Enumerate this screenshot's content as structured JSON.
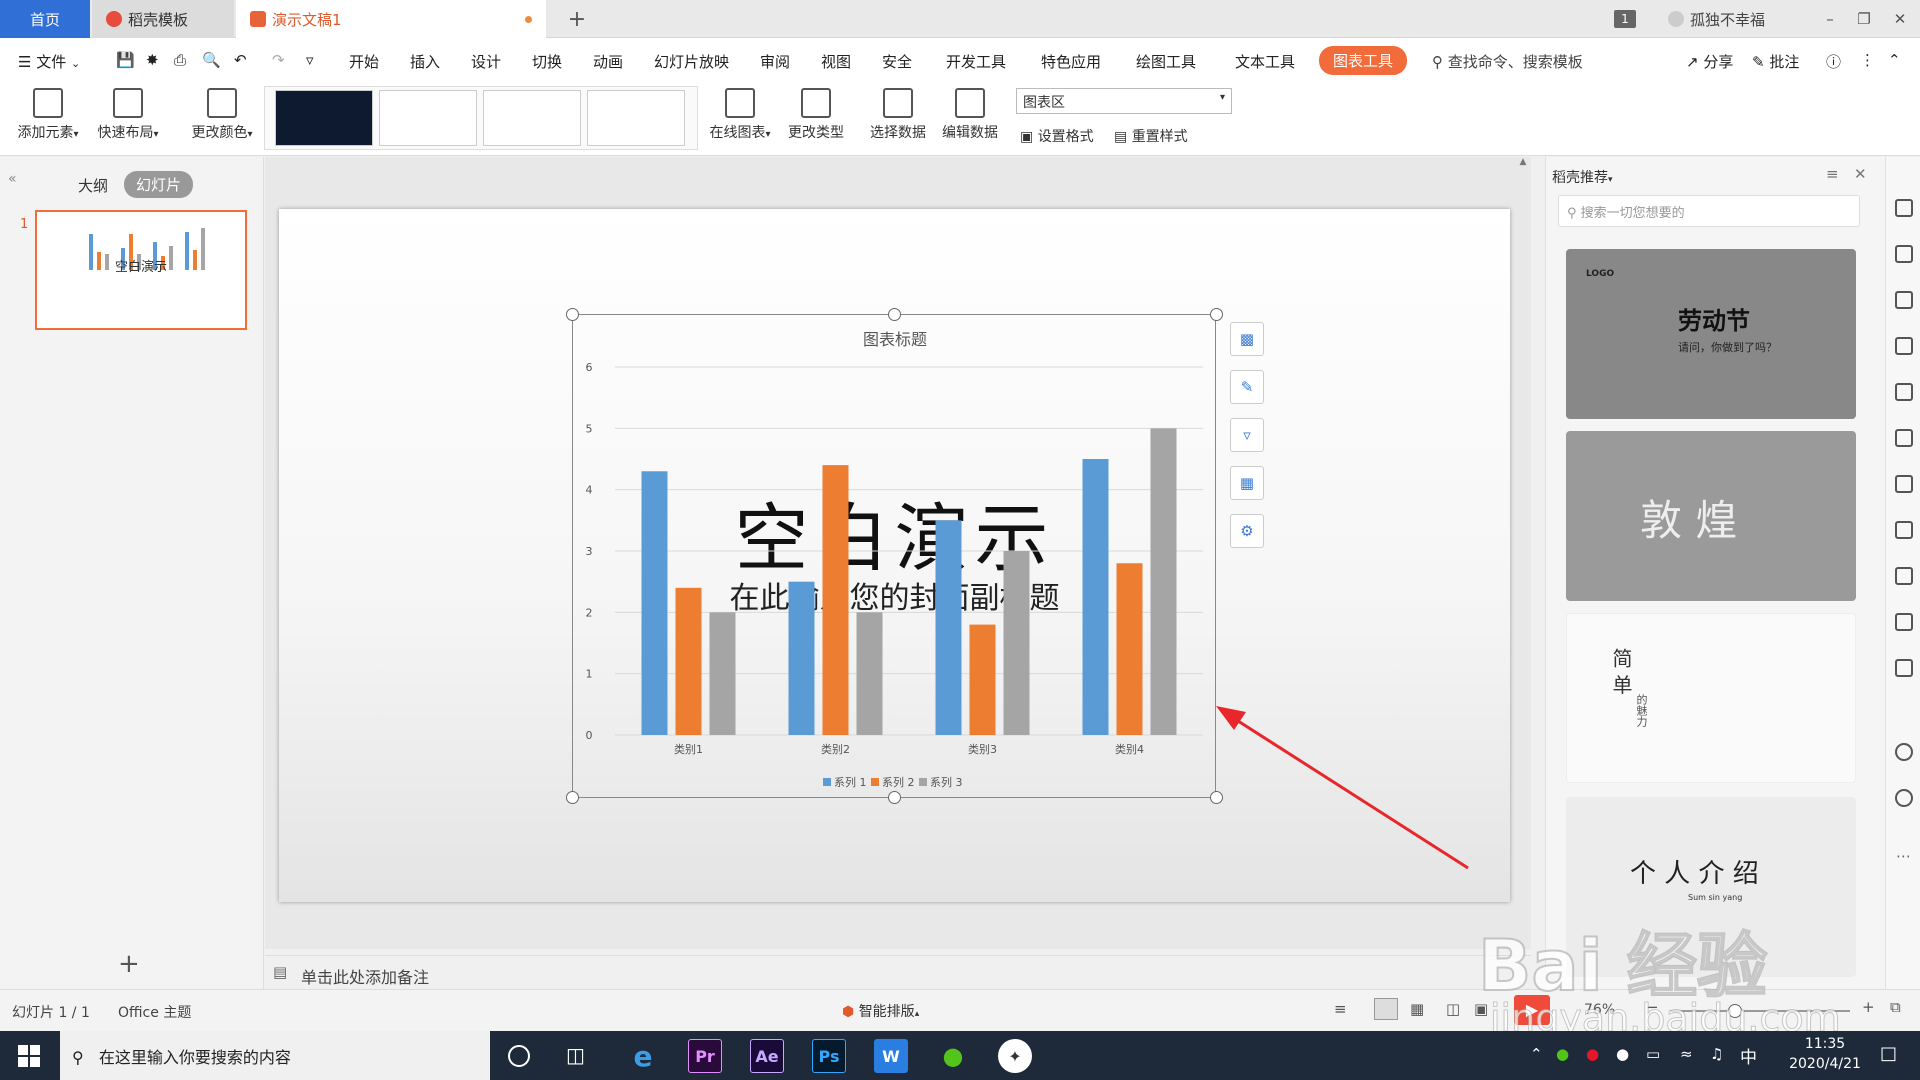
{
  "tabs": {
    "home": "首页",
    "template": "稻壳模板",
    "doc": "演示文稿1",
    "add": "+",
    "badge": "1",
    "user": "孤独不幸福"
  },
  "menu": {
    "file": "文件",
    "items": [
      "开始",
      "插入",
      "设计",
      "切换",
      "动画",
      "幻灯片放映",
      "审阅",
      "视图",
      "安全",
      "开发工具",
      "特色应用",
      "绘图工具",
      "文本工具"
    ],
    "active": "图表工具",
    "search": "查找命令、搜索模板",
    "share": "分享",
    "comment": "批注"
  },
  "ribbon": {
    "add_element": "添加元素",
    "quick_layout": "快速布局",
    "change_color": "更改颜色",
    "online_chart": "在线图表",
    "change_type": "更改类型",
    "select_data": "选择数据",
    "edit_data": "编辑数据",
    "area_select": "图表区",
    "set_format": "设置格式",
    "reset_style": "重置样式"
  },
  "left_panel": {
    "outline": "大纲",
    "slides": "幻灯片",
    "slide_number": "1",
    "thumb_title": "空白演示"
  },
  "slide": {
    "title": "空白演示",
    "subtitle": "在此输入您的封面副标题"
  },
  "notes": "单击此处添加备注",
  "right_panel": {
    "title": "稻壳推荐",
    "search_placeholder": "搜索一切您想要的",
    "cards": [
      {
        "title": "劳动节",
        "subtitle": "请问，你做到了吗？",
        "logo": "LOGO"
      },
      {
        "title": "敦 煌"
      },
      {
        "title": "简 单",
        "subtitle": "的魅力"
      },
      {
        "title": "个 人 介 绍",
        "subtitle": "Sum sin yang"
      }
    ]
  },
  "status": {
    "slide_info": "幻灯片 1 / 1",
    "theme": "Office 主题",
    "smart_layout": "智能排版",
    "zoom": "76%"
  },
  "taskbar": {
    "search": "在这里输入你要搜索的内容",
    "ime": "中",
    "time": "11:35",
    "date": "2020/4/21",
    "apps": [
      "Pr",
      "Ae",
      "Ps",
      "W"
    ]
  },
  "watermark": {
    "logo": "Bai 经验",
    "url": "jingyan.baidu.com"
  },
  "colors": {
    "series1": "#5b9bd5",
    "series2": "#ed7d31",
    "series3": "#a5a5a5",
    "accent": "#f26b3a"
  },
  "chart_data": {
    "type": "bar",
    "title": "图表标题",
    "categories": [
      "类别1",
      "类别2",
      "类别3",
      "类别4"
    ],
    "series": [
      {
        "name": "系列 1",
        "values": [
          4.3,
          2.5,
          3.5,
          4.5
        ]
      },
      {
        "name": "系列 2",
        "values": [
          2.4,
          4.4,
          1.8,
          2.8
        ]
      },
      {
        "name": "系列 3",
        "values": [
          2.0,
          2.0,
          3.0,
          5.0
        ]
      }
    ],
    "ylim": [
      0,
      6
    ],
    "yticks": [
      "0",
      "1",
      "2",
      "3",
      "4",
      "5",
      "6"
    ],
    "grid": true,
    "legend": "bottom"
  }
}
